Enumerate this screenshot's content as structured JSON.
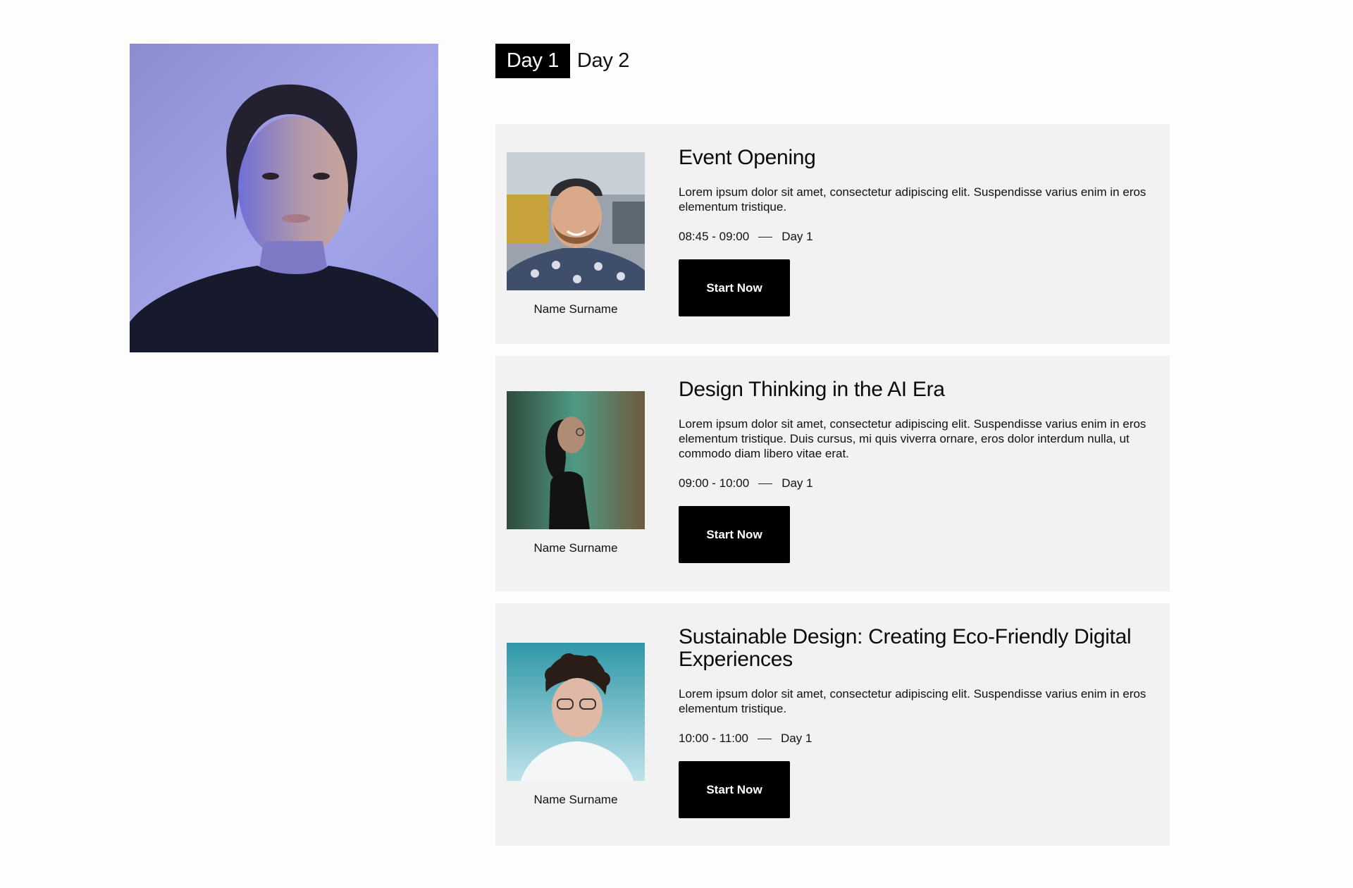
{
  "tabs": [
    {
      "label": "Day 1",
      "active": true
    },
    {
      "label": "Day 2",
      "active": false
    }
  ],
  "featured_image": {
    "icon": "woman-portrait-photo"
  },
  "sessions": [
    {
      "speaker_name": "Name Surname",
      "photo_icon": "bearded-man-cap-photo",
      "title": "Event Opening",
      "description": "Lorem ipsum dolor sit amet, consectetur adipiscing elit. Suspendisse varius enim in eros elementum tristique.",
      "time": "08:45 - 09:00",
      "day": "Day 1",
      "button_label": "Start Now"
    },
    {
      "speaker_name": "Name Surname",
      "photo_icon": "woman-profile-green-photo",
      "title": "Design Thinking in the AI Era",
      "description": "Lorem ipsum dolor sit amet, consectetur adipiscing elit. Suspendisse varius enim in eros elementum tristique. Duis cursus, mi quis viverra ornare, eros dolor interdum nulla, ut commodo diam libero vitae erat.",
      "time": "09:00 - 10:00",
      "day": "Day 1",
      "button_label": "Start Now"
    },
    {
      "speaker_name": "Name Surname",
      "photo_icon": "curly-hair-man-glasses-photo",
      "title": "Sustainable Design: Creating Eco-Friendly Digital Experiences",
      "description": "Lorem ipsum dolor sit amet, consectetur adipiscing elit. Suspendisse varius enim in eros elementum tristique.",
      "time": "10:00 - 11:00",
      "day": "Day 1",
      "button_label": "Start Now"
    }
  ],
  "colors": {
    "page_bg": "#fdfdfd",
    "card_bg": "#f2f2f2",
    "button_bg": "#000000",
    "button_text": "#ffffff"
  }
}
